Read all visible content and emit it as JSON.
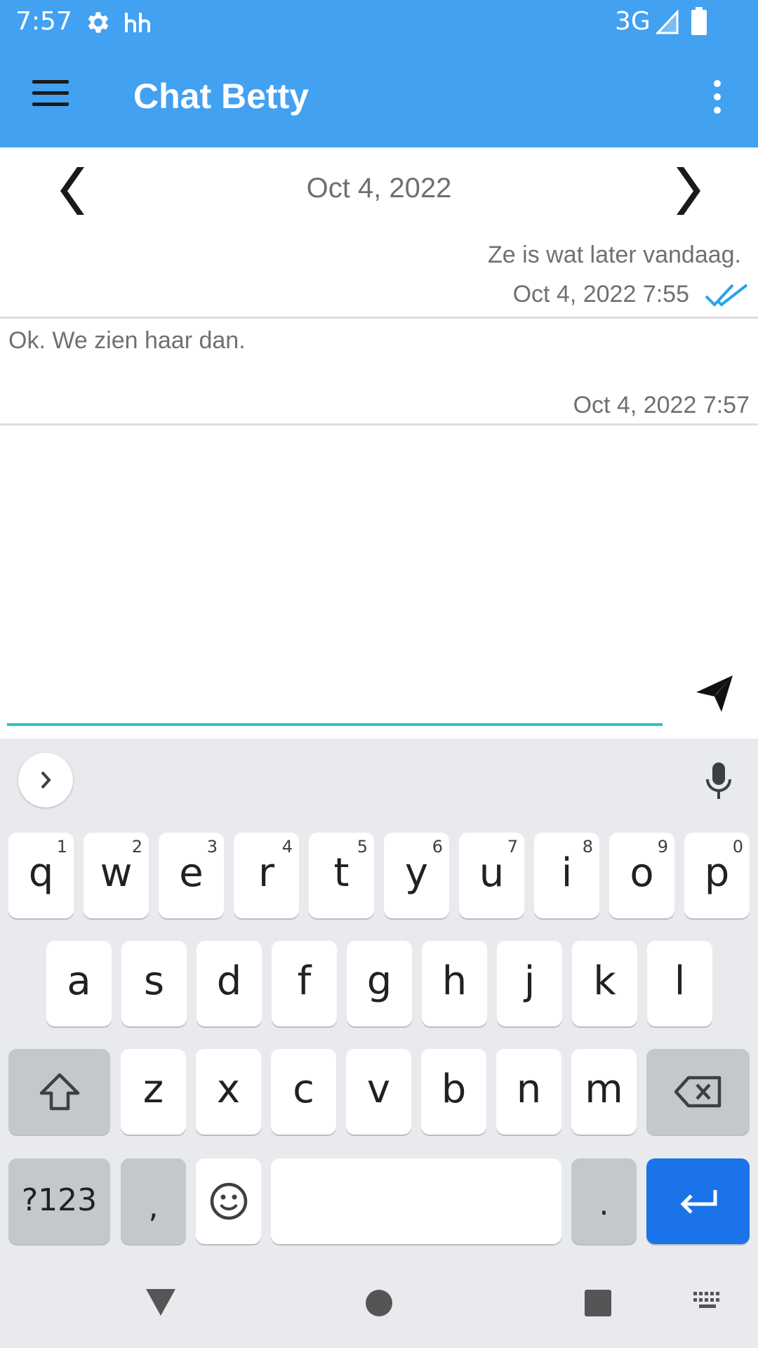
{
  "status": {
    "time": "7:57",
    "network": "3G",
    "icons": [
      "gear-icon",
      "hh-notification-icon",
      "signal-icon",
      "battery-icon"
    ]
  },
  "app_bar": {
    "title": "Chat Betty",
    "menu_icon": "hamburger-menu-icon",
    "overflow_icon": "more-vert-icon",
    "color": "#42a1f0"
  },
  "date_nav": {
    "date": "Oct 4, 2022",
    "prev_icon": "chevron-left-icon",
    "next_icon": "chevron-right-icon"
  },
  "messages": [
    {
      "direction": "outgoing",
      "text": "Ze is wat later vandaag.",
      "timestamp": "Oct 4, 2022 7:55",
      "status_icon": "double-check-icon"
    },
    {
      "direction": "incoming",
      "text": "Ok. We zien haar dan.",
      "timestamp": "Oct 4, 2022 7:57"
    }
  ],
  "compose": {
    "value": "",
    "placeholder": "",
    "send_icon": "send-icon",
    "accent": "#26c6c6"
  },
  "keyboard": {
    "row1": [
      {
        "letter": "q",
        "num": "1"
      },
      {
        "letter": "w",
        "num": "2"
      },
      {
        "letter": "e",
        "num": "3"
      },
      {
        "letter": "r",
        "num": "4"
      },
      {
        "letter": "t",
        "num": "5"
      },
      {
        "letter": "y",
        "num": "6"
      },
      {
        "letter": "u",
        "num": "7"
      },
      {
        "letter": "i",
        "num": "8"
      },
      {
        "letter": "o",
        "num": "9"
      },
      {
        "letter": "p",
        "num": "0"
      }
    ],
    "row2": [
      "a",
      "s",
      "d",
      "f",
      "g",
      "h",
      "j",
      "k",
      "l"
    ],
    "row3": [
      "z",
      "x",
      "c",
      "v",
      "b",
      "n",
      "m"
    ],
    "symbols_label": "?123",
    "comma": ",",
    "period": ".",
    "enter_color": "#1a73e8",
    "icons": [
      "expand-arrow-icon",
      "microphone-icon",
      "shift-icon",
      "backspace-icon",
      "emoji-icon",
      "enter-icon"
    ]
  },
  "nav_bar": {
    "icons": [
      "back-icon",
      "home-icon",
      "recents-icon",
      "keyboard-switch-icon"
    ]
  }
}
